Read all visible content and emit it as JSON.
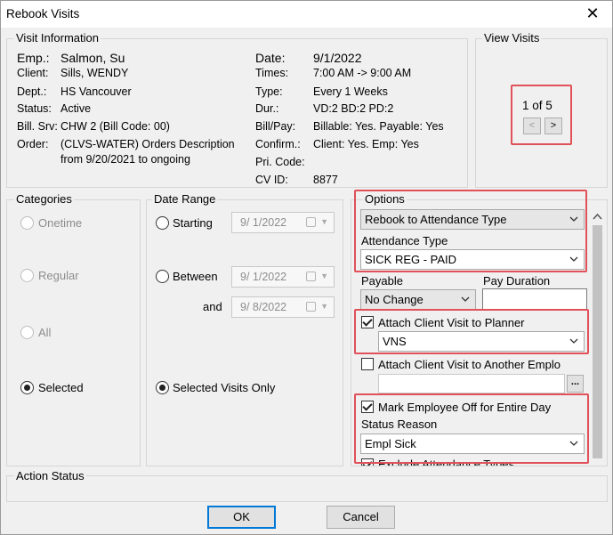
{
  "window": {
    "title": "Rebook Visits"
  },
  "visit_info": {
    "label": "Visit Information",
    "emp_label": "Emp.:",
    "emp": "Salmon, Su",
    "client_label": "Client:",
    "client": "Sills, WENDY",
    "dept_label": "Dept.:",
    "dept": "HS Vancouver",
    "status_label": "Status:",
    "status": "Active",
    "bill_srv_label": "Bill. Srv:",
    "bill_srv": "CHW 2 (Bill Code: 00)",
    "order_label": "Order:",
    "order_line1": "(CLVS-WATER) Orders Description",
    "order_line2": "from 9/20/2021 to ongoing",
    "date_label": "Date:",
    "date": "9/1/2022",
    "times_label": "Times:",
    "times": "7:00 AM -> 9:00 AM",
    "type_label": "Type:",
    "type": "Every 1 Weeks",
    "dur_label": "Dur.:",
    "dur": "VD:2  BD:2  PD:2",
    "bill_pay_label": "Bill/Pay:",
    "bill_pay": "Billable: Yes. Payable: Yes",
    "confirm_label": "Confirm.:",
    "confirm": "Client: Yes. Emp: Yes",
    "pri_code_label": "Pri. Code:",
    "pri_code": "",
    "cv_id_label": "CV ID:",
    "cv_id": "8877"
  },
  "view_visits": {
    "label": "View Visits",
    "counter": "1 of 5",
    "prev": "<",
    "next": ">"
  },
  "categories": {
    "label": "Categories",
    "items": [
      {
        "label": "Onetime",
        "checked": false,
        "disabled": true
      },
      {
        "label": "Regular",
        "checked": false,
        "disabled": true
      },
      {
        "label": "All",
        "checked": false,
        "disabled": true
      },
      {
        "label": "Selected",
        "checked": true,
        "disabled": false
      }
    ]
  },
  "date_range": {
    "label": "Date Range",
    "starting_label": "Starting",
    "starting_date": "9/ 1/2022",
    "between_label": "Between",
    "between_date": "9/ 1/2022",
    "and_label": "and",
    "and_date": "9/ 8/2022",
    "selected_only_label": "Selected Visits Only"
  },
  "options": {
    "label": "Options",
    "rebook_mode": "Rebook to Attendance Type",
    "attendance_type_label": "Attendance Type",
    "attendance_type": "SICK REG - PAID",
    "payable_label": "Payable",
    "payable": "No Change",
    "pay_duration_label": "Pay Duration",
    "pay_duration": "",
    "attach_planner_label": "Attach Client Visit to Planner",
    "attach_planner_checked": true,
    "planner": "VNS",
    "attach_another_label": "Attach Client Visit to Another Emplo",
    "attach_another_checked": false,
    "another_emp": "",
    "ellipsis": "...",
    "mark_off_label": "Mark Employee Off for Entire Day",
    "mark_off_checked": true,
    "status_reason_label": "Status Reason",
    "status_reason": "Empl Sick",
    "exclude_label": "Exclude Attendance Types"
  },
  "action_status": {
    "label": "Action Status"
  },
  "buttons": {
    "ok": "OK",
    "cancel": "Cancel"
  },
  "colors": {
    "highlight": "#e0515a",
    "accent": "#0078d7"
  }
}
